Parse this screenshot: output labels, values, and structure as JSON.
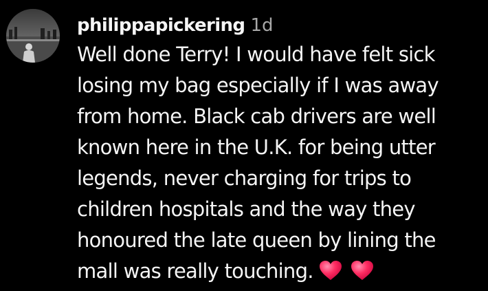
{
  "comment": {
    "username": "philippapickering",
    "timestamp": "1d",
    "lines": [
      "Well done Terry! I would have felt sick",
      "losing my bag especially if I was away",
      "from home. Black cab drivers are well",
      "known here in the U.K. for being utter",
      "legends, never charging for trips to",
      "children hospitals and the way they",
      "honoured the late queen by lining the",
      "mall was really touching."
    ],
    "emojis": [
      "heart-icon",
      "heart-icon"
    ],
    "colors": {
      "background": "#000000",
      "text": "#f5f5f5",
      "timestamp": "#a8a8a8",
      "heart": "#ff2e63"
    }
  }
}
